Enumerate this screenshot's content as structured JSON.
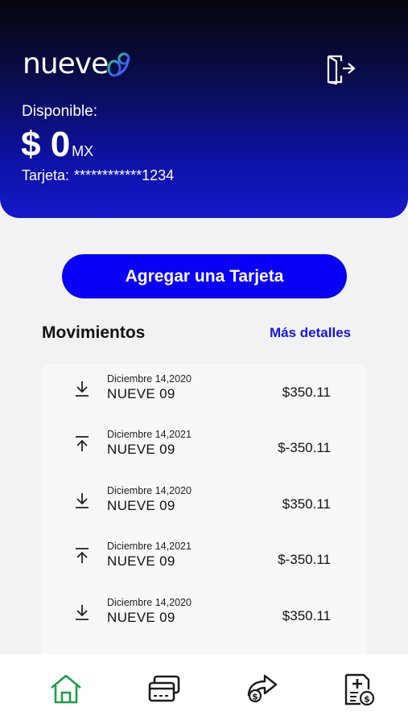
{
  "header": {
    "logo_text": "nueve",
    "logo_suffix": "09",
    "available_label": "Disponible:",
    "balance": "$ 0",
    "currency": "MX",
    "card_label": "Tarjeta:",
    "card_number": "************1234"
  },
  "actions": {
    "add_card_label": "Agregar una Tarjeta"
  },
  "movements": {
    "title": "Movimientos",
    "more_label": "Más detalles",
    "items": [
      {
        "date": "Diciembre 14,2020",
        "name": "NUEVE 09",
        "amount": "$350.11",
        "direction": "in"
      },
      {
        "date": "Diciembre 14,2021",
        "name": "NUEVE 09",
        "amount": "$-350.11",
        "direction": "out"
      },
      {
        "date": "Diciembre 14,2020",
        "name": "NUEVE 09",
        "amount": "$350.11",
        "direction": "in"
      },
      {
        "date": "Diciembre 14,2021",
        "name": "NUEVE 09",
        "amount": "$-350.11",
        "direction": "out"
      },
      {
        "date": "Diciembre 14,2020",
        "name": "NUEVE 09",
        "amount": "$350.11",
        "direction": "in"
      }
    ]
  },
  "nav": {
    "items": [
      {
        "icon": "home-icon",
        "active": true
      },
      {
        "icon": "cards-icon",
        "active": false
      },
      {
        "icon": "transfer-icon",
        "active": false
      },
      {
        "icon": "payments-icon",
        "active": false
      }
    ]
  },
  "colors": {
    "accent": "#0a00f5",
    "link": "#1a14e6",
    "nav_active": "#1e9e4a",
    "nav_inactive": "#1b1b1b"
  }
}
